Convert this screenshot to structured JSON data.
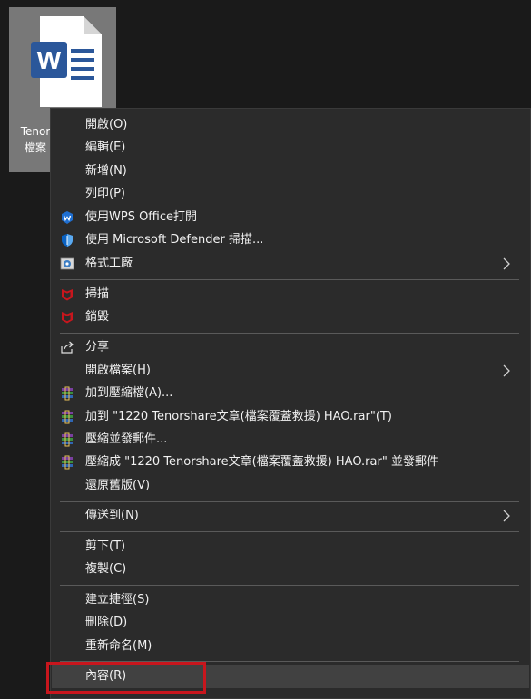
{
  "desktop": {
    "file_label_line1": "Tenor",
    "file_label_line2": "檔案",
    "file_icon_letter": "W"
  },
  "colors": {
    "word_blue": "#2b579a",
    "wps_blue": "#1f6fd1",
    "defender_blue": "#0a62c2",
    "mcafee_red": "#c8161d",
    "highlight_red": "#c8161d"
  },
  "menu": {
    "items": [
      {
        "label": "開啟(O)",
        "icon": ""
      },
      {
        "label": "編輯(E)",
        "icon": ""
      },
      {
        "label": "新增(N)",
        "icon": ""
      },
      {
        "label": "列印(P)",
        "icon": ""
      },
      {
        "label": "使用WPS Office打開",
        "icon": "wps-icon"
      },
      {
        "label": "使用 Microsoft Defender 掃描...",
        "icon": "defender-shield-icon"
      },
      {
        "label": "格式工廠",
        "icon": "format-factory-icon",
        "submenu": true
      },
      {
        "label": "掃描",
        "icon": "mcafee-icon"
      },
      {
        "label": "銷毀",
        "icon": "mcafee-icon"
      },
      {
        "label": "分享",
        "icon": "share-icon"
      },
      {
        "label": "開啟檔案(H)",
        "icon": "",
        "submenu": true
      },
      {
        "label": "加到壓縮檔(A)...",
        "icon": "winrar-icon"
      },
      {
        "label": "加到 \"1220 Tenorshare文章(檔案覆蓋救援) HAO.rar\"(T)",
        "icon": "winrar-icon"
      },
      {
        "label": "壓縮並發郵件...",
        "icon": "winrar-icon"
      },
      {
        "label": "壓縮成 \"1220 Tenorshare文章(檔案覆蓋救援) HAO.rar\" 並發郵件",
        "icon": "winrar-icon"
      },
      {
        "label": "還原舊版(V)",
        "icon": ""
      },
      {
        "label": "傳送到(N)",
        "icon": "",
        "submenu": true
      },
      {
        "label": "剪下(T)",
        "icon": ""
      },
      {
        "label": "複製(C)",
        "icon": ""
      },
      {
        "label": "建立捷徑(S)",
        "icon": ""
      },
      {
        "label": "刪除(D)",
        "icon": ""
      },
      {
        "label": "重新命名(M)",
        "icon": ""
      },
      {
        "label": "內容(R)",
        "icon": "",
        "highlighted": true
      }
    ]
  }
}
